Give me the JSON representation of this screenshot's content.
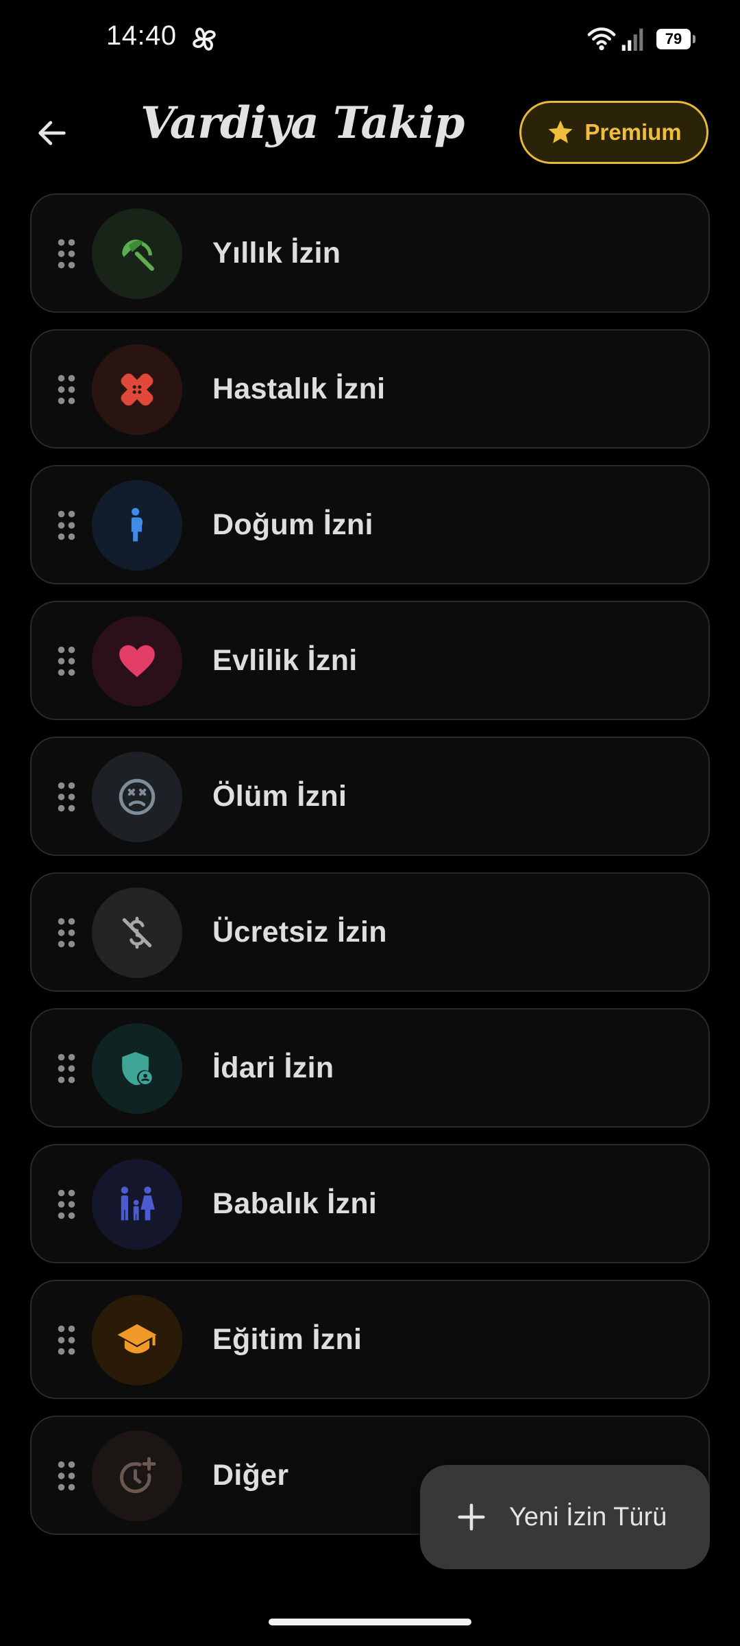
{
  "status_bar": {
    "time": "14:40",
    "battery": "79",
    "icons": [
      "fan-icon",
      "wifi-icon",
      "signal-icon",
      "battery-icon"
    ]
  },
  "app_bar": {
    "title": "Vardiya Takip",
    "premium_label": "Premium",
    "back_icon": "arrow-left-icon",
    "premium_icon": "star-icon"
  },
  "leave_types": [
    {
      "label": "Yıllık İzin",
      "icon": "umbrella-icon",
      "color": "#5cae4e",
      "bg": "#182418"
    },
    {
      "label": "Hastalık İzni",
      "icon": "bandage-icon",
      "color": "#e0493a",
      "bg": "#2a1513"
    },
    {
      "label": "Doğum İzni",
      "icon": "pregnant-woman-icon",
      "color": "#3f8ce6",
      "bg": "#111c2c"
    },
    {
      "label": "Evlilik İzni",
      "icon": "heart-icon",
      "color": "#e33d68",
      "bg": "#2b1019"
    },
    {
      "label": "Ölüm İzni",
      "icon": "sad-face-icon",
      "color": "#7f8c99",
      "bg": "#1d2125"
    },
    {
      "label": "Ücretsiz İzin",
      "icon": "money-off-icon",
      "color": "#a9a9a9",
      "bg": "#242424"
    },
    {
      "label": "İdari İzin",
      "icon": "admin-shield-icon",
      "color": "#3fa597",
      "bg": "#0f2422"
    },
    {
      "label": "Babalık İzni",
      "icon": "family-icon",
      "color": "#4c5ccf",
      "bg": "#14162c"
    },
    {
      "label": "Eğitim İzni",
      "icon": "graduation-cap-icon",
      "color": "#f19a2a",
      "bg": "#2a1b08"
    },
    {
      "label": "Diğer",
      "icon": "clock-add-icon",
      "color": "#6b5850",
      "bg": "#1b1614"
    }
  ],
  "fab": {
    "label": "Yeni İzin Türü",
    "icon": "plus-icon"
  },
  "colors": {
    "background": "#000000",
    "card": "#0c0c0c",
    "accent": "#e9b93a"
  }
}
